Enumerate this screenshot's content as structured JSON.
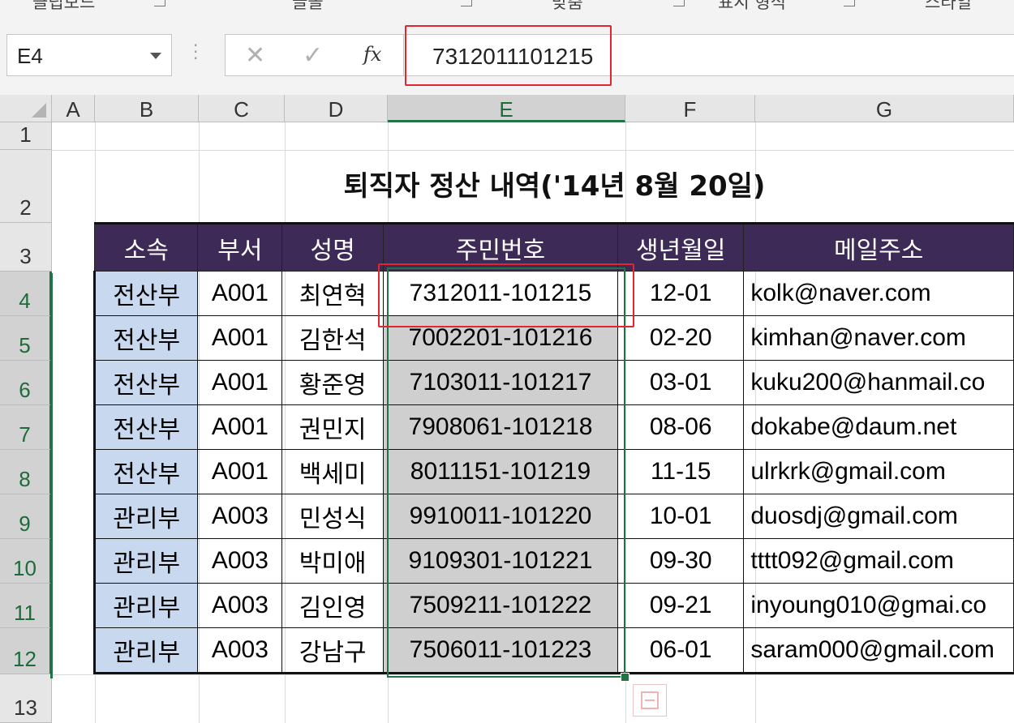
{
  "ribbon": {
    "labels": [
      "클립보드",
      "글꼴",
      "맞춤",
      "표시 형식",
      "스타일"
    ]
  },
  "formula_bar": {
    "name_box": "E4",
    "cancel_glyph": "✕",
    "enter_glyph": "✓",
    "fx_label": "fx",
    "formula_value": "7312011101215"
  },
  "grid": {
    "columns": [
      "A",
      "B",
      "C",
      "D",
      "E",
      "F",
      "G"
    ],
    "rows": [
      "1",
      "2",
      "3",
      "4",
      "5",
      "6",
      "7",
      "8",
      "9",
      "10",
      "11",
      "12",
      "13"
    ],
    "active_cell": "E4"
  },
  "sheet": {
    "title": "퇴직자 정산 내역('14년 8월 20일)",
    "headers": [
      "소속",
      "부서",
      "성명",
      "주민번호",
      "생년월일",
      "메일주소"
    ],
    "rows": [
      {
        "dept": "전산부",
        "code": "A001",
        "name": "최연혁",
        "ssn": "7312011-101215",
        "birth": "12-01",
        "email": "kolk@naver.com"
      },
      {
        "dept": "전산부",
        "code": "A001",
        "name": "김한석",
        "ssn": "7002201-101216",
        "birth": "02-20",
        "email": "kimhan@naver.com"
      },
      {
        "dept": "전산부",
        "code": "A001",
        "name": "황준영",
        "ssn": "7103011-101217",
        "birth": "03-01",
        "email": "kuku200@hanmail.co"
      },
      {
        "dept": "전산부",
        "code": "A001",
        "name": "권민지",
        "ssn": "7908061-101218",
        "birth": "08-06",
        "email": "dokabe@daum.net"
      },
      {
        "dept": "전산부",
        "code": "A001",
        "name": "백세미",
        "ssn": "8011151-101219",
        "birth": "11-15",
        "email": "ulrkrk@gmail.com"
      },
      {
        "dept": "관리부",
        "code": "A003",
        "name": "민성식",
        "ssn": "9910011-101220",
        "birth": "10-01",
        "email": "duosdj@gmail.com"
      },
      {
        "dept": "관리부",
        "code": "A003",
        "name": "박미애",
        "ssn": "9109301-101221",
        "birth": "09-30",
        "email": "tttt092@gmail.com"
      },
      {
        "dept": "관리부",
        "code": "A003",
        "name": "김인영",
        "ssn": "7509211-101222",
        "birth": "09-21",
        "email": "inyoung010@gmai.co"
      },
      {
        "dept": "관리부",
        "code": "A003",
        "name": "강남구",
        "ssn": "7506011-101223",
        "birth": "06-01",
        "email": "saram000@gmail.com"
      }
    ]
  },
  "colors": {
    "header_bg": "#3d2a56",
    "dept_bg": "#c8d9ef",
    "selection_bg": "#cfcfcf",
    "selection_border": "#217346",
    "highlight_box": "#e0262e"
  }
}
